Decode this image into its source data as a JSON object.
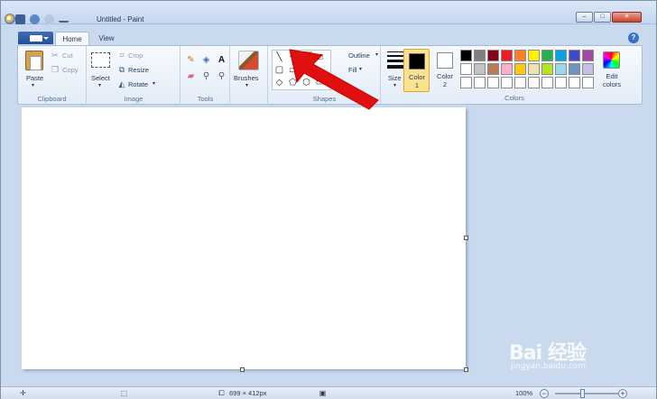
{
  "window": {
    "title": "Untitled - Paint"
  },
  "title_controls": {
    "minimize": "–",
    "maximize": "□",
    "close": "✕"
  },
  "tabs": [
    {
      "label": "Home",
      "active": true
    },
    {
      "label": "View",
      "active": false
    }
  ],
  "help": "?",
  "ribbon": {
    "clipboard": {
      "paste": "Paste",
      "cut": "Cut",
      "copy": "Copy",
      "group": "Clipboard"
    },
    "image": {
      "select": "Select",
      "crop": "Crop",
      "resize": "Resize",
      "rotate": "Rotate",
      "group": "Image"
    },
    "tools": {
      "group": "Tools",
      "text_tool": "A"
    },
    "brushes": {
      "label": "Brushes"
    },
    "shapes": {
      "outline": "Outline",
      "fill": "Fill",
      "group": "Shapes"
    },
    "size": {
      "label": "Size"
    },
    "colors": {
      "color1_label": "Color",
      "color1_num": "1",
      "color2_label": "Color",
      "color2_num": "2",
      "edit_colors_1": "Edit",
      "edit_colors_2": "colors",
      "group": "Colors",
      "palette_row1": [
        "#000000",
        "#7f7f7f",
        "#880015",
        "#ed1c24",
        "#ff7f27",
        "#fff200",
        "#22b14c",
        "#00a2e8",
        "#3f48cc",
        "#a349a4"
      ],
      "palette_row2": [
        "#ffffff",
        "#c3c3c3",
        "#b97a57",
        "#ffaec9",
        "#ffc90e",
        "#efe4b0",
        "#b5e61d",
        "#99d9ea",
        "#7092be",
        "#c8bfe7"
      ],
      "palette_row3": [
        "#ffffff",
        "#ffffff",
        "#ffffff",
        "#ffffff",
        "#ffffff",
        "#ffffff",
        "#ffffff",
        "#ffffff",
        "#ffffff",
        "#ffffff"
      ],
      "accent_selected": "#fbe28e"
    }
  },
  "statusbar": {
    "canvas_size": "699 × 412px",
    "zoom": "100%"
  },
  "watermark": {
    "main": "Bai 经验",
    "sub": "jingyan.baidu.com"
  },
  "annotation_color": "#e01010"
}
